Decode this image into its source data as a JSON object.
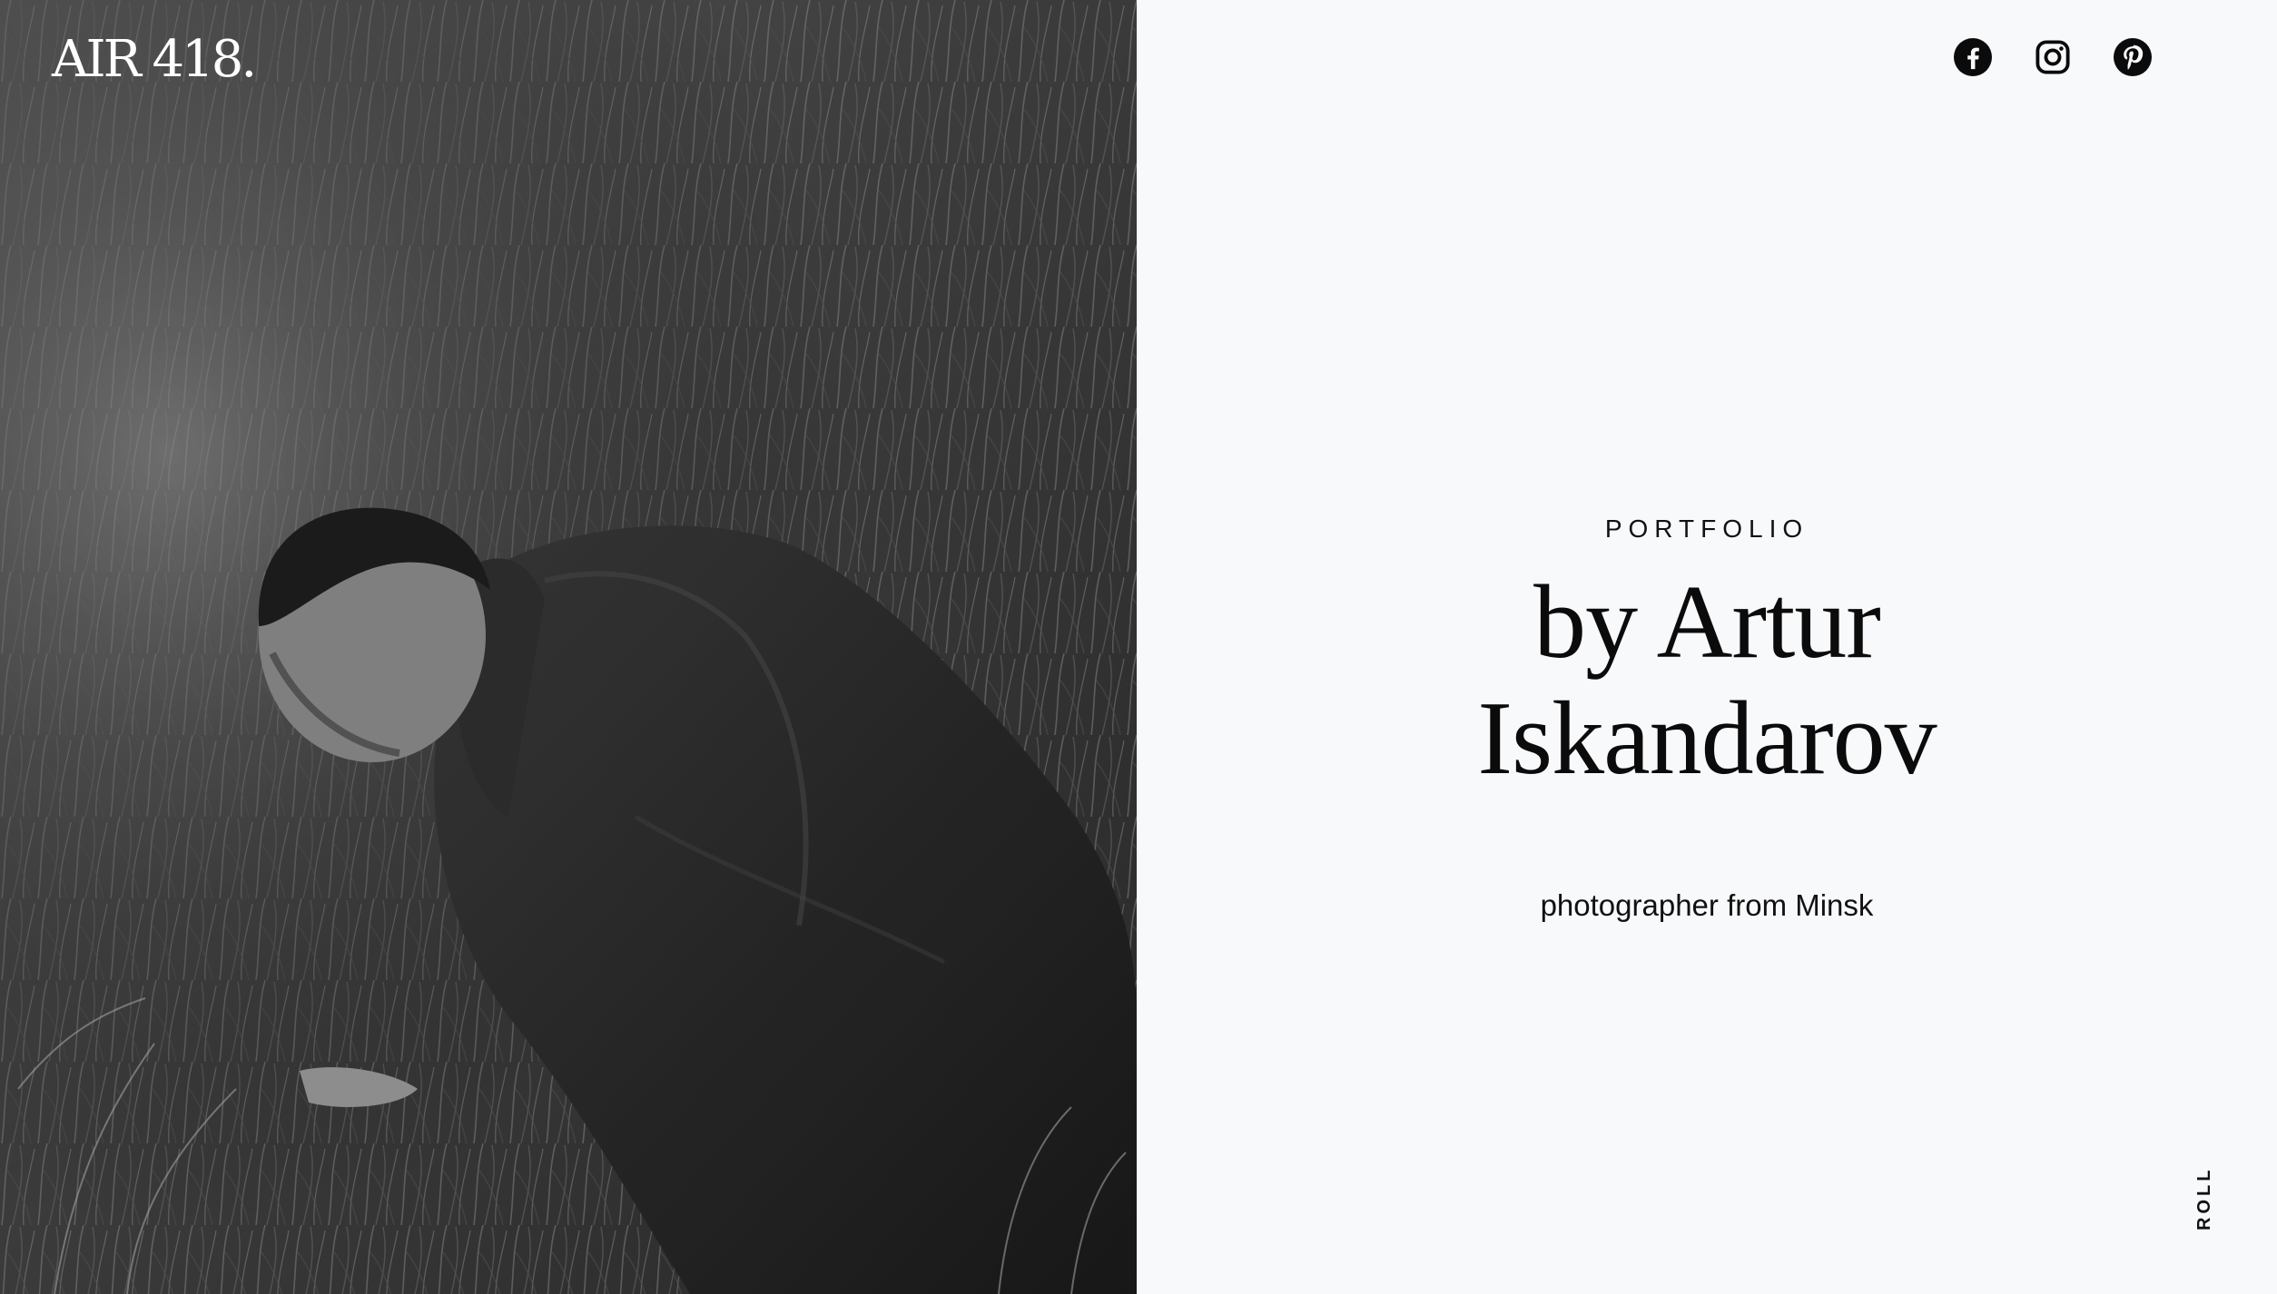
{
  "brand": {
    "logo_text": "AIR 418."
  },
  "social": [
    {
      "name": "facebook",
      "icon": "facebook-icon"
    },
    {
      "name": "instagram",
      "icon": "instagram-icon"
    },
    {
      "name": "pinterest",
      "icon": "pinterest-icon"
    }
  ],
  "hero": {
    "eyebrow": "PORTFOLIO",
    "title_line1": "by Artur",
    "title_line2": "Iskandarov",
    "subtitle": "photographer from Minsk"
  },
  "scroll_hint": "ROLL",
  "colors": {
    "background": "#f8f9fb",
    "text": "#0b0b0b",
    "logo": "#ffffff"
  }
}
